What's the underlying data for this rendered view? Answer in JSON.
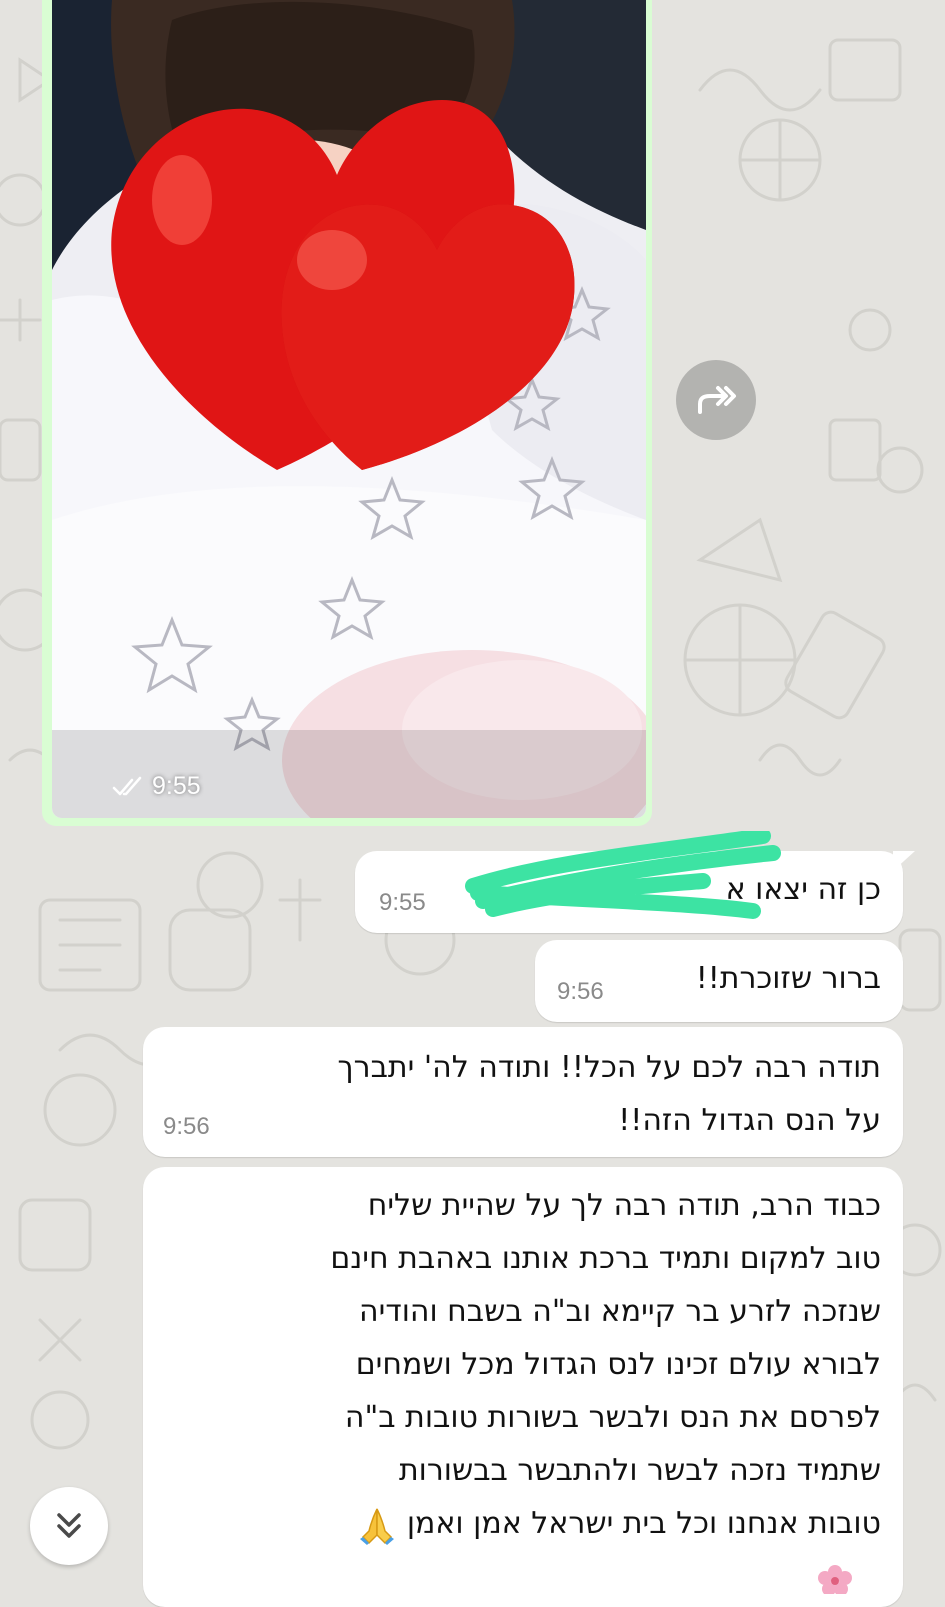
{
  "image_message": {
    "time": "9:55",
    "status_icon": "double-check-icon"
  },
  "forward_button": {
    "icon": "forward-icon"
  },
  "messages": [
    {
      "lines": [
        "כן זה יצאו א"
      ],
      "time": "9:55"
    },
    {
      "lines": [
        "ברור שזוכרת!!"
      ],
      "time": "9:56"
    },
    {
      "lines": [
        "תודה רבה לכם על הכל!! ותודה לה' יתברך",
        "על הנס הגדול הזה!!"
      ],
      "time": "9:56"
    },
    {
      "lines": [
        "כבוד הרב, תודה רבה לך על שהיית שליח",
        "טוב למקום ותמיד ברכת אותנו באהבת חינם",
        "שנזכה לזרע בר קיימא וב\"ה בשבח והודיה",
        "לבורא עולם זכינו לנס הגדול מכל ושמחים",
        "לפרסם את הנס ולבשר בשורות טובות ב\"ה",
        "שתמיד נזכה לבשר ולהתבשר בבשורות",
        "טובות אנחנו וכל בית ישראל אמן ואמן"
      ],
      "emoji": "folded-hands-icon"
    }
  ],
  "scroll_button": {
    "icon": "double-chevron-down-icon"
  },
  "colors": {
    "background": "#e4e3df",
    "outgoing_bubble": "#d9fdd3",
    "incoming_bubble": "#ffffff",
    "redaction_marker": "#3de3a3",
    "heart": "#e01515"
  }
}
